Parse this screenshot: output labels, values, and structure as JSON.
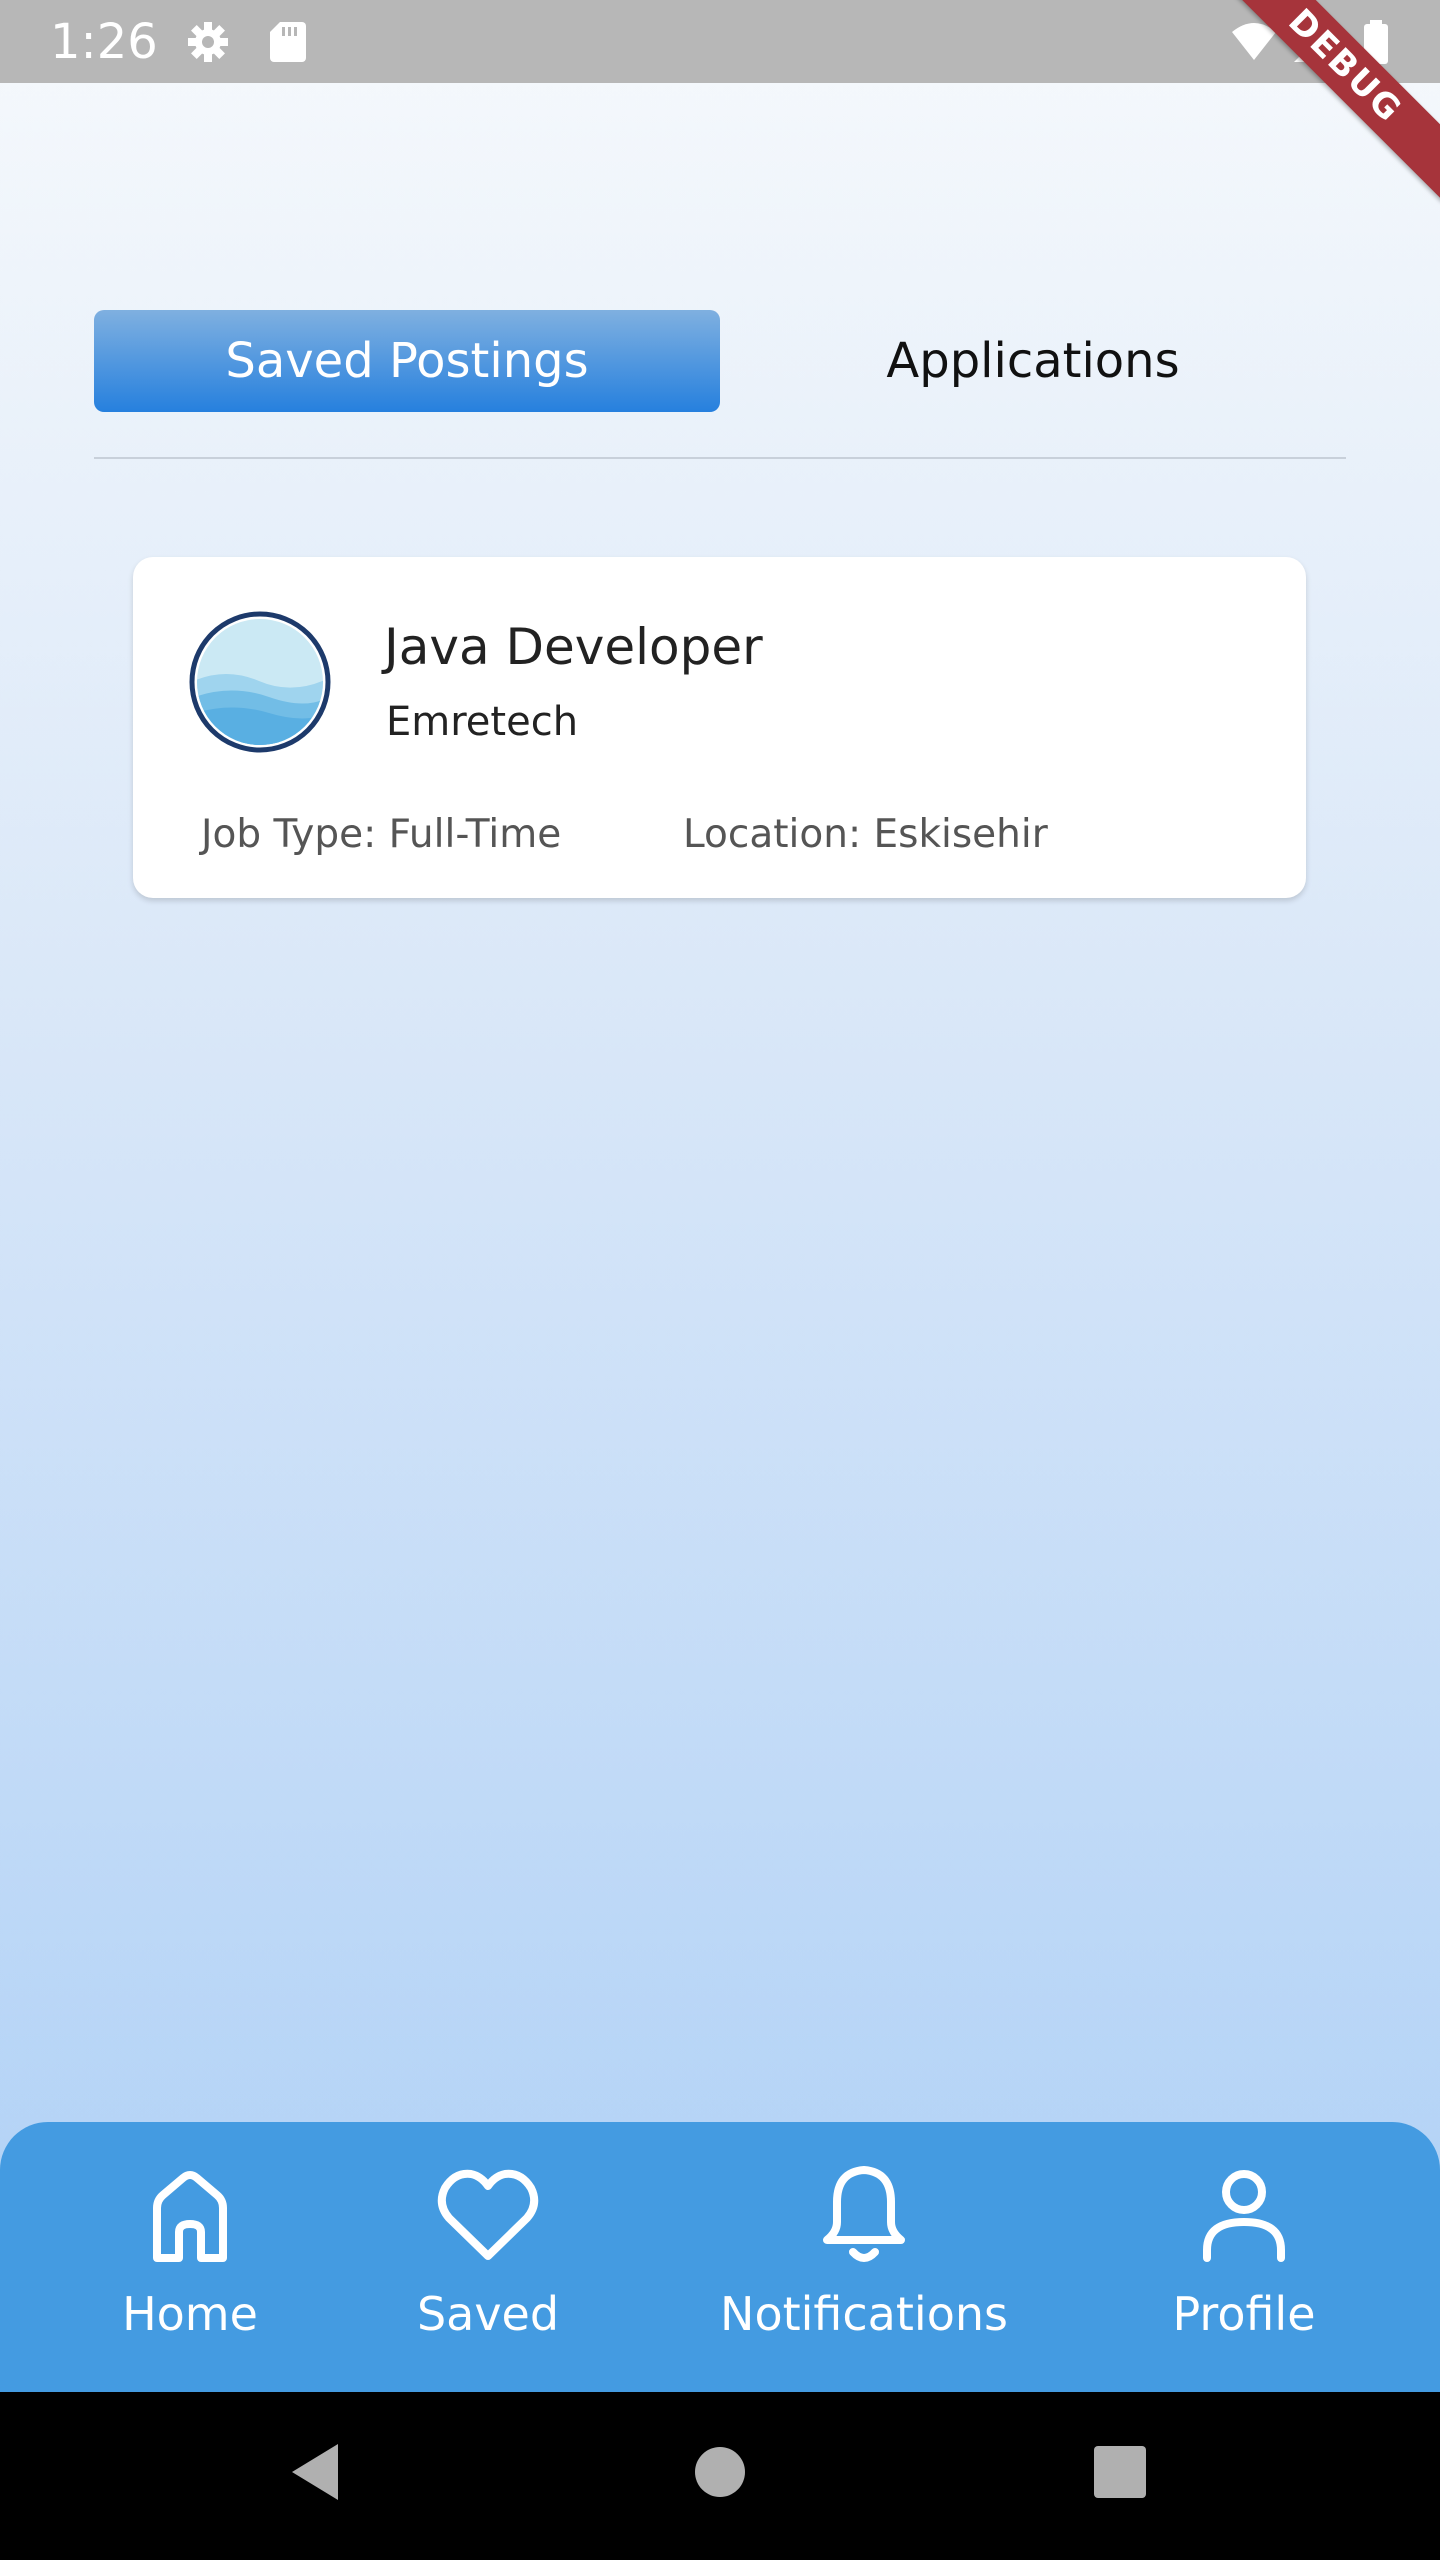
{
  "status_bar": {
    "time": "1:26",
    "debug_label": "DEBUG",
    "icons": [
      "settings-icon",
      "sd-card-icon",
      "wifi-icon",
      "signal-icon",
      "battery-icon"
    ]
  },
  "tabs": [
    {
      "label": "Saved Postings",
      "active": true
    },
    {
      "label": "Applications",
      "active": false
    }
  ],
  "saved_postings": [
    {
      "title": "Java Developer",
      "company": "Emretech",
      "job_type": "Job Type: Full-Time",
      "location": "Location: Eskisehir",
      "logo_icon": "company-logo-icon"
    }
  ],
  "bottom_nav": [
    {
      "label": "Home",
      "icon": "home-icon"
    },
    {
      "label": "Saved",
      "icon": "heart-icon"
    },
    {
      "label": "Notifications",
      "icon": "bell-icon"
    },
    {
      "label": "Profile",
      "icon": "user-icon"
    }
  ],
  "colors": {
    "accent": "#2680de",
    "nav_bar": "#449be1",
    "status_bar": "#b7b7b7",
    "debug_ribbon": "#a6343b"
  }
}
